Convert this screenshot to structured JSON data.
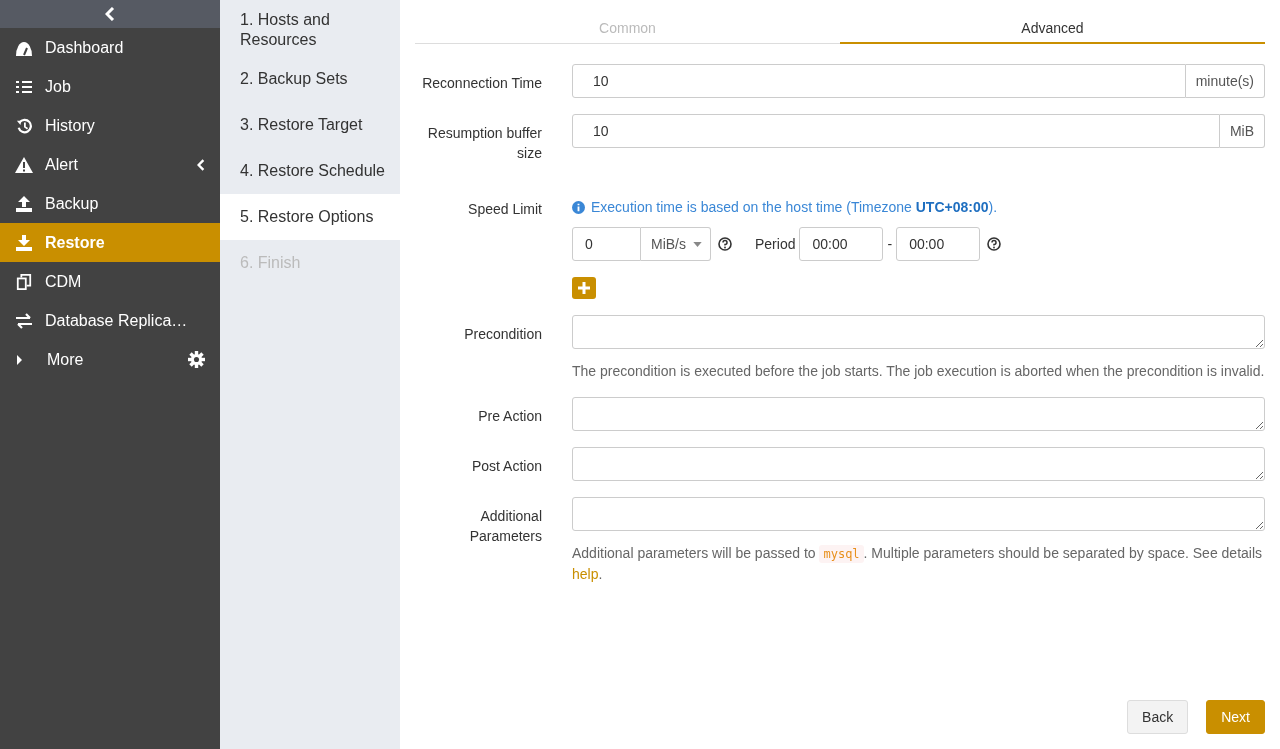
{
  "sidebar": {
    "items": [
      {
        "kind": "dashboard",
        "label": "Dashboard",
        "selected": false
      },
      {
        "kind": "job",
        "label": "Job",
        "selected": false
      },
      {
        "kind": "history",
        "label": "History",
        "selected": false
      },
      {
        "kind": "alert",
        "label": "Alert",
        "selected": false,
        "expandable": true
      },
      {
        "kind": "backup",
        "label": "Backup",
        "selected": false
      },
      {
        "kind": "restore",
        "label": "Restore",
        "selected": true
      },
      {
        "kind": "cdm",
        "label": "CDM",
        "selected": false
      },
      {
        "kind": "replication",
        "label": "Database Replica…",
        "selected": false
      },
      {
        "kind": "more",
        "label": "More",
        "selected": false
      }
    ]
  },
  "steps": [
    {
      "label": "1. Hosts and Resources",
      "selected": false,
      "disabled": false
    },
    {
      "label": "2. Backup Sets",
      "selected": false,
      "disabled": false
    },
    {
      "label": "3. Restore Target",
      "selected": false,
      "disabled": false
    },
    {
      "label": "4. Restore Schedule",
      "selected": false,
      "disabled": false
    },
    {
      "label": "5. Restore Options",
      "selected": true,
      "disabled": false
    },
    {
      "label": "6. Finish",
      "selected": false,
      "disabled": true
    }
  ],
  "tabs": [
    {
      "label": "Common",
      "selected": false
    },
    {
      "label": "Advanced",
      "selected": true
    }
  ],
  "form": [
    {
      "kind": "addon",
      "label": "Reconnection Time",
      "value": "10",
      "unit": "minute(s)"
    },
    {
      "kind": "addon",
      "label": "Resumption buffer size",
      "value": "10",
      "unit": "MiB"
    },
    {
      "kind": "speed",
      "label": "Speed Limit",
      "note": "Execution time is based on the host time (Timezone **UTC+08:00**).",
      "value": "0",
      "unit": "MiB/s",
      "period_label": "Period",
      "from": "00:00",
      "separator": "-",
      "to": "00:00"
    },
    {
      "kind": "textarea",
      "label": "Precondition",
      "help": "The precondition is executed before the job starts. The job execution is aborted when the precondition is invalid."
    },
    {
      "kind": "textarea",
      "label": "Pre Action"
    },
    {
      "kind": "textarea",
      "label": "Post Action"
    },
    {
      "kind": "textarea",
      "label": "Additional Parameters",
      "help_parts": {
        "before": "Additional parameters will be passed to ",
        "code": "mysql",
        "after": ". Multiple parameters should be separated by space. See details ",
        "link": "help",
        "end": "."
      }
    }
  ],
  "buttons": [
    {
      "kind": "back",
      "label": "Back"
    },
    {
      "kind": "next",
      "label": "Next"
    }
  ]
}
